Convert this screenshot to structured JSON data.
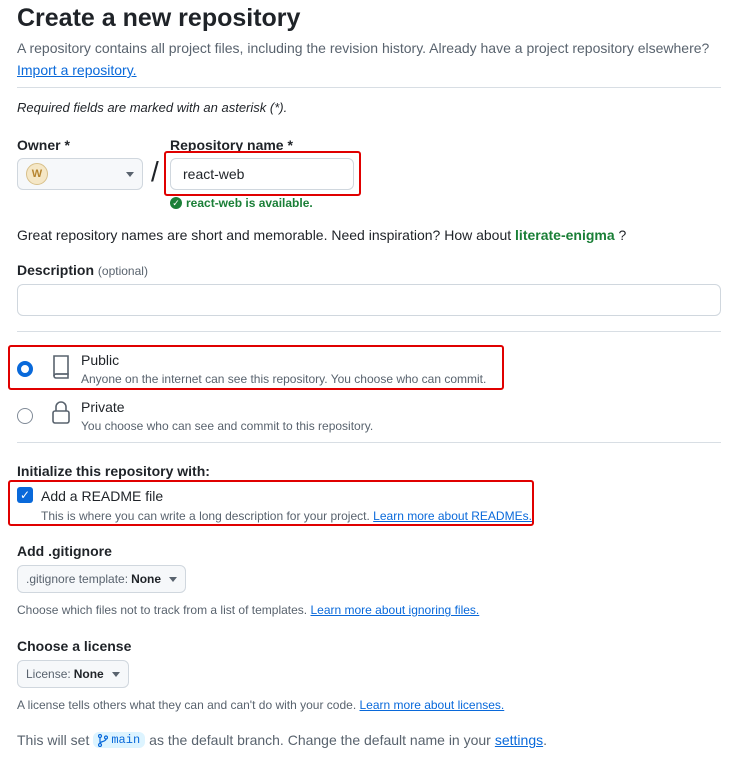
{
  "header": {
    "title": "Create a new repository",
    "lead": "A repository contains all project files, including the revision history. Already have a project repository elsewhere?",
    "import_link": "Import a repository."
  },
  "required_note": "Required fields are marked with an asterisk (*).",
  "owner": {
    "label": "Owner *",
    "avatar_text": "W"
  },
  "slash": "/",
  "repo_name": {
    "label": "Repository name *",
    "value": "react-web",
    "availability": "react-web is available."
  },
  "suggestion": {
    "text": "Great repository names are short and memorable. Need inspiration? How about",
    "name": "literate-enigma",
    "end": "?"
  },
  "description": {
    "label": "Description",
    "optional": "(optional)",
    "value": ""
  },
  "visibility": {
    "public": {
      "title": "Public",
      "subtitle": "Anyone on the internet can see this repository. You choose who can commit.",
      "selected": true
    },
    "private": {
      "title": "Private",
      "subtitle": "You choose who can see and commit to this repository.",
      "selected": false
    }
  },
  "init": {
    "heading": "Initialize this repository with:",
    "readme_label": "Add a README file",
    "readme_checked": true,
    "readme_note": "This is where you can write a long description for your project.",
    "readme_link": "Learn more about READMEs."
  },
  "gitignore": {
    "heading": "Add .gitignore",
    "select_prefix": ".gitignore template:",
    "select_value": "None",
    "note": "Choose which files not to track from a list of templates.",
    "link": "Learn more about ignoring files."
  },
  "license": {
    "heading": "Choose a license",
    "select_prefix": "License:",
    "select_value": "None",
    "note": "A license tells others what they can and can't do with your code.",
    "link": "Learn more about licenses."
  },
  "default_branch": {
    "prefix": "This will set",
    "branch": "main",
    "middle": "as the default branch. Change the default name in your",
    "link": "settings",
    "end": "."
  },
  "colors": {
    "accent": "#0969da",
    "success": "#1a7f37",
    "highlight": "#e00000"
  }
}
